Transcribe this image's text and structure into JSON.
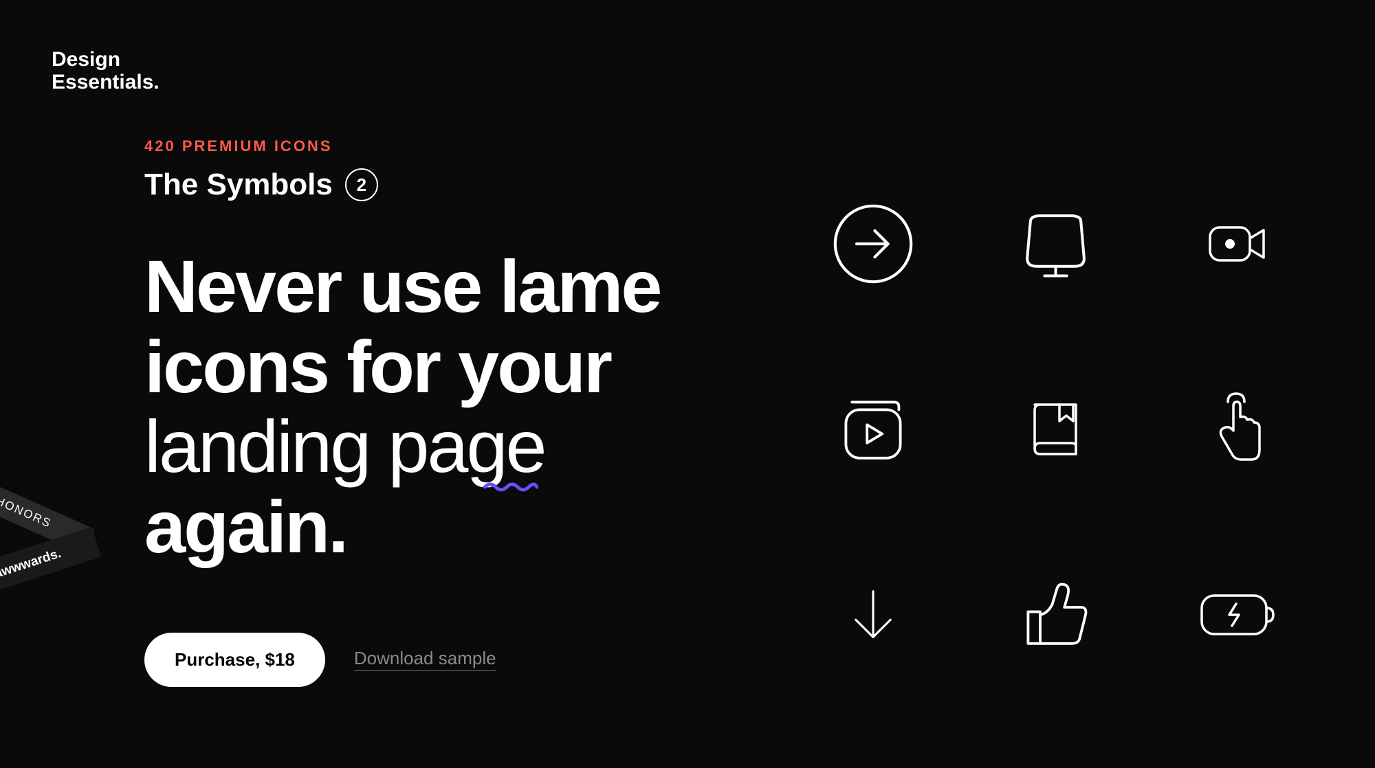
{
  "logo": {
    "line1": "Design",
    "line2": "Essentials."
  },
  "eyebrow": "420 PREMIUM ICONS",
  "subtitle": "The Symbols",
  "version": "2",
  "headline": {
    "line1": "Never use lame",
    "line2": "icons for your",
    "line3_light": "landing page",
    "line4": "again."
  },
  "cta": {
    "purchase": "Purchase, $18",
    "download": "Download sample"
  },
  "awards": {
    "top": "HONORS",
    "bottom": "awwwards."
  },
  "icons": [
    "arrow-right-circle-icon",
    "monitor-icon",
    "video-camera-icon",
    "play-stack-icon",
    "bookmark-book-icon",
    "tap-finger-icon",
    "arrow-down-icon",
    "thumbs-up-icon",
    "battery-charging-icon"
  ]
}
